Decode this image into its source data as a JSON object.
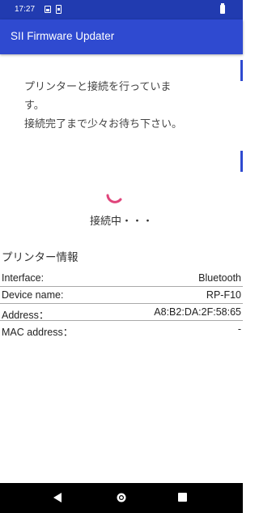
{
  "status_bar": {
    "time": "17:27",
    "icons": [
      "image-icon",
      "sim-icon",
      "battery-icon"
    ]
  },
  "app_bar": {
    "title": "SII Firmware Updater"
  },
  "message": {
    "line1": "プリンターと接続を行っていま",
    "line2": "す。",
    "line3": "接続完了まで少々お待ち下さい。"
  },
  "progress": {
    "label": "接続中・・・",
    "color": "#e0457b"
  },
  "printer_info": {
    "title": "プリンター情報",
    "rows": [
      {
        "key": "Interface:",
        "value": "Bluetooth"
      },
      {
        "key": "Device name:",
        "value": "RP-F10"
      },
      {
        "key": "Address：",
        "value": "A8:B2:DA:2F:58:65"
      },
      {
        "key": "MAC address：",
        "value": "-"
      }
    ]
  },
  "nav_bar": {
    "icons": [
      "back-icon",
      "home-icon",
      "recent-apps-icon"
    ]
  },
  "colors": {
    "status_bar": "#213bb0",
    "app_bar": "#2f4ad0",
    "spinner": "#e0457b"
  }
}
